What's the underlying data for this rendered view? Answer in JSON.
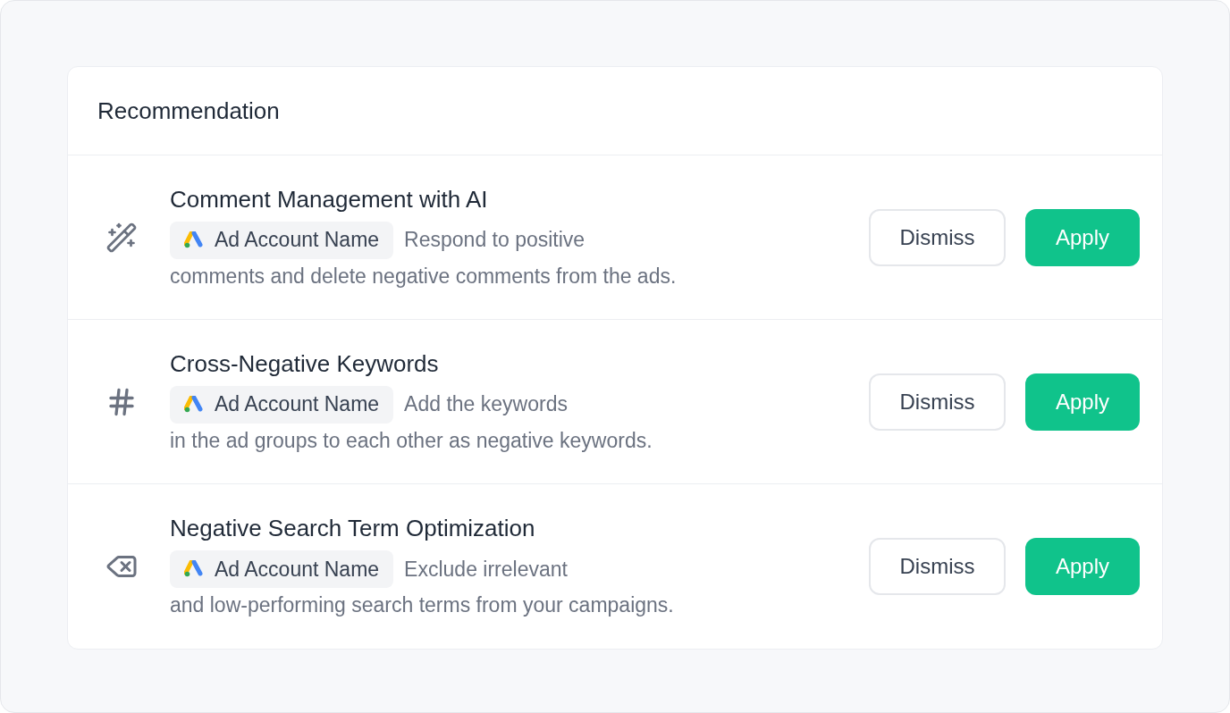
{
  "card": {
    "title": "Recommendation",
    "items": [
      {
        "kind": "wand",
        "title": "Comment Management with AI",
        "account": "Ad Account Name",
        "description": [
          "Respond to positive",
          "comments and delete negative comments from the ads."
        ],
        "buttons": [
          "Dismiss",
          "Apply"
        ]
      },
      {
        "kind": "hash",
        "title": "Cross-Negative Keywords",
        "account": "Ad Account Name",
        "description": [
          "Add the keywords",
          "in the ad groups to each other as negative keywords."
        ],
        "buttons": [
          "Dismiss",
          "Apply"
        ]
      },
      {
        "kind": "backspace",
        "title": "Negative Search Term Optimization",
        "account": "Ad Account Name",
        "description": [
          "Exclude irrelevant",
          "and low-performing search terms from your campaigns."
        ],
        "buttons": [
          "Dismiss",
          "Apply"
        ]
      }
    ]
  }
}
